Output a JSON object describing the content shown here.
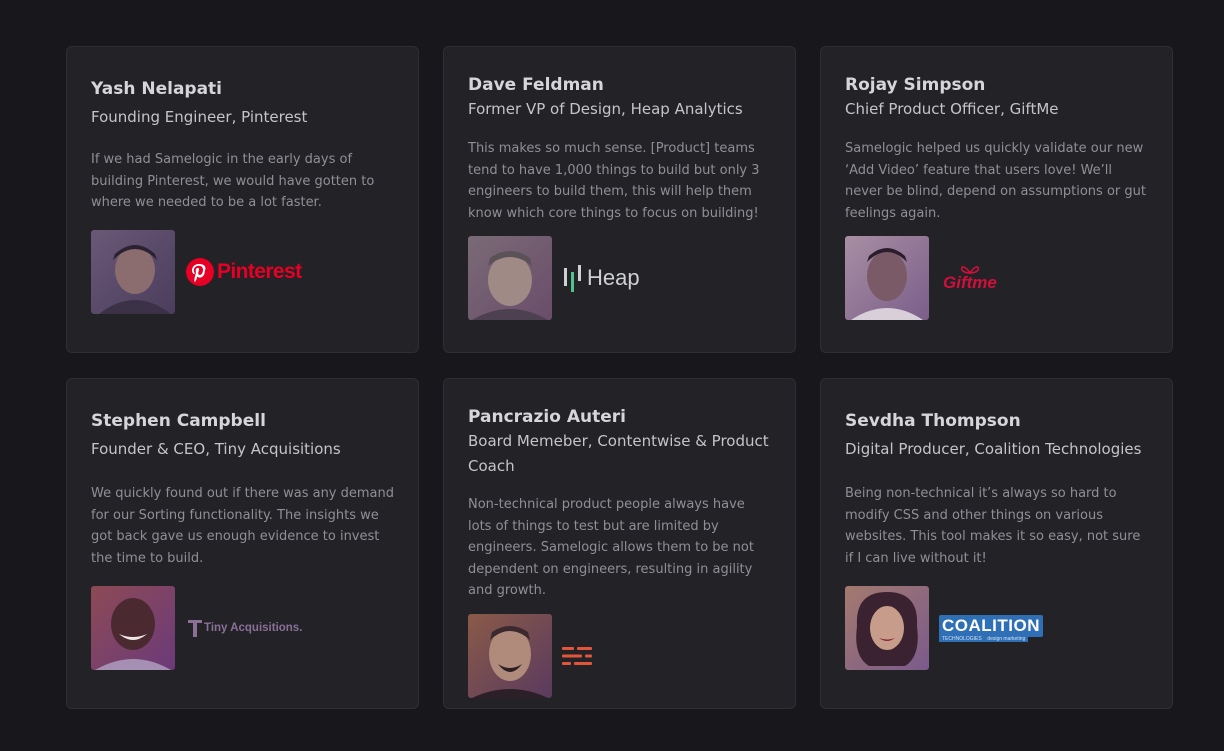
{
  "testimonials": [
    {
      "name": "Yash Nelapati",
      "role": "Founding Engineer, Pinterest",
      "quote": "If we had Samelogic in the early days of building Pinterest, we would have gotten to where we needed to be a lot faster.",
      "logo_text": "Pinterest",
      "logo_icon": "pinterest-icon",
      "logo_color": "#e60023"
    },
    {
      "name": "Dave Feldman",
      "role": "Former VP of Design, Heap Analytics",
      "quote": "This makes so much sense. [Product] teams tend to have 1,000 things to build but only 3 engineers to build them, this will help them know which core things to focus on building!",
      "logo_text": "Heap",
      "logo_icon": "heap-icon",
      "logo_color": "#cfd0d2"
    },
    {
      "name": "Rojay Simpson",
      "role": "Chief Product Officer, GiftMe",
      "quote": "Samelogic helped us quickly validate our new ‘Add Video’ feature that users love! We’ll never be blind, depend on assumptions or gut feelings again.",
      "logo_text": "Giftme",
      "logo_icon": "gift-icon",
      "logo_color": "#d0103a"
    },
    {
      "name": "Stephen Campbell",
      "role": "Founder & CEO, Tiny Acquisitions",
      "quote": "We quickly found out if there was any demand for our Sorting functionality. The insights we got back gave us enough evidence to invest the time to build.",
      "logo_text": "Tiny Acquisitions.",
      "logo_icon": "tiny-acquisitions-icon",
      "logo_color": "#8a6f96"
    },
    {
      "name": "Pancrazio Auteri",
      "role": "Board Memeber, Contentwise & Product Coach",
      "quote": "Non-technical product people always have lots of things to test but are limited by engineers. Samelogic allows them to be not dependent on engineers, resulting in agility and growth.",
      "logo_text": "",
      "logo_icon": "contentwise-icon",
      "logo_color": "#e2553a"
    },
    {
      "name": "Sevdha Thompson",
      "role": "Digital Producer, Coalition Technologies",
      "quote": "Being non-technical it’s always so hard to modify CSS and other things on various websites. This tool makes it so easy, not sure if I can live without it!",
      "logo_text": "COALITION",
      "logo_subtext": "TECHNOLOGIES    design marketing",
      "logo_icon": "coalition-icon",
      "logo_color": "#2f6fb5"
    }
  ]
}
